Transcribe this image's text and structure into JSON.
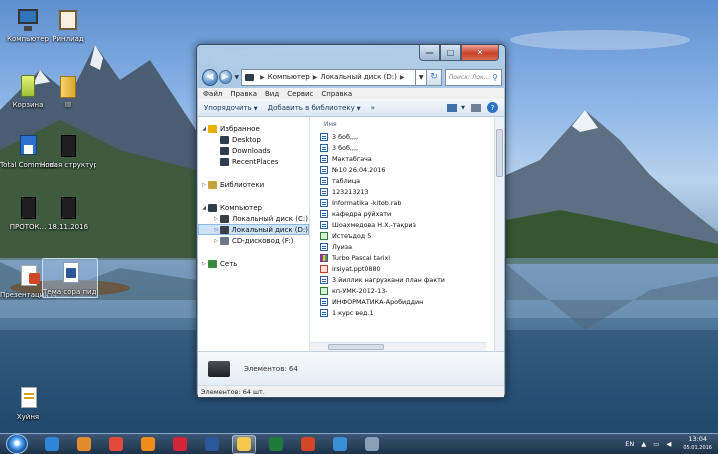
{
  "desktop": {
    "icons": [
      {
        "label": "Компьютер",
        "icon": "computer-icon"
      },
      {
        "label": "Ринлиад",
        "icon": "book-icon"
      },
      {
        "label": "Корзина",
        "icon": "recycle-bin-icon"
      },
      {
        "label": "III",
        "icon": "folder-icon"
      },
      {
        "label": "Total Commander",
        "icon": "floppy-icon"
      },
      {
        "label": "Новая структура...",
        "icon": "book-icon"
      },
      {
        "label": "ПРОТОК...",
        "icon": "book-icon"
      },
      {
        "label": "18.11.2016",
        "icon": "book-icon"
      },
      {
        "label": "Презентация Microsoft P...",
        "icon": "powerpoint-icon"
      },
      {
        "label": "Тема сора пидагога",
        "icon": "word-document-icon"
      },
      {
        "label": "Хуйня",
        "icon": "document-icon"
      }
    ]
  },
  "window": {
    "buttons": {
      "minimize": "—",
      "maximize": "□",
      "close": "✕"
    },
    "address": {
      "breadcrumbs": [
        "Компьютер",
        "Локальный диск (D:)"
      ]
    },
    "search": {
      "placeholder": "Поиск: Лок..."
    },
    "menu": [
      "Файл",
      "Правка",
      "Вид",
      "Сервис",
      "Справка"
    ],
    "commands": {
      "organize": "Упорядочить",
      "add_to_library": "Добавить в библиотеку",
      "more": "»"
    },
    "nav_pane": [
      {
        "label": "Избранное",
        "level": 0,
        "expander": "◢",
        "icon": "star-icon",
        "color": "#e8b100"
      },
      {
        "label": "Desktop",
        "level": 1,
        "expander": "",
        "icon": "desktop-icon",
        "color": "#2f3d4e"
      },
      {
        "label": "Downloads",
        "level": 1,
        "expander": "",
        "icon": "downloads-icon",
        "color": "#2f3d4e"
      },
      {
        "label": "RecentPlaces",
        "level": 1,
        "expander": "",
        "icon": "recent-places-icon",
        "color": "#2f3d4e"
      },
      {
        "gap": true
      },
      {
        "label": "Библиотеки",
        "level": 0,
        "expander": "▷",
        "icon": "library-icon",
        "color": "#c9a13a"
      },
      {
        "gap": true
      },
      {
        "label": "Компьютер",
        "level": 0,
        "expander": "◢",
        "icon": "computer-icon",
        "color": "#2f3d4e"
      },
      {
        "label": "Локальный диск (C:)",
        "level": 1,
        "expander": "▷",
        "icon": "drive-icon",
        "color": "#3a3f46"
      },
      {
        "label": "Локальный диск (D:)",
        "level": 1,
        "expander": "▷",
        "icon": "drive-icon",
        "color": "#3a3f46",
        "selected": true
      },
      {
        "label": "CD-дисковод (F:)",
        "level": 1,
        "expander": "▷",
        "icon": "cd-drive-icon",
        "color": "#6b7785"
      },
      {
        "gap": true
      },
      {
        "label": "Сеть",
        "level": 0,
        "expander": "▷",
        "icon": "network-icon",
        "color": "#3c8a3c"
      }
    ],
    "column_header": "Имя",
    "files": [
      {
        "name": "3 боб,,,,",
        "type": "word"
      },
      {
        "name": "3 боб,,,,",
        "type": "word"
      },
      {
        "name": "Мактабгача",
        "type": "word"
      },
      {
        "name": "№10 26.04.2016",
        "type": "word"
      },
      {
        "name": "таблица",
        "type": "word"
      },
      {
        "name": "123213213",
        "type": "word"
      },
      {
        "name": "Informatika -kitob.rab",
        "type": "word"
      },
      {
        "name": "кафедра рўйхати",
        "type": "word"
      },
      {
        "name": "Шоахмедова Н.Х.-тақриз",
        "type": "word"
      },
      {
        "name": "Истеъдод 5",
        "type": "excel"
      },
      {
        "name": "Луиза",
        "type": "word"
      },
      {
        "name": "Turbo Pascal tarixi",
        "type": "rar"
      },
      {
        "name": "irsiyat.ppt0880",
        "type": "ppt"
      },
      {
        "name": "3 йиллик нагрузкани план факти",
        "type": "word"
      },
      {
        "name": "кп-УМК-2012-13-",
        "type": "excel"
      },
      {
        "name": "ИНФОРМАТИКА-Аробиддин",
        "type": "word"
      },
      {
        "name": "1 курс вед.1",
        "type": "word"
      }
    ],
    "details": {
      "count_text": "Элементов: 64"
    },
    "status": {
      "text": "Элементов: 64 шт."
    }
  },
  "taskbar": {
    "items": [
      {
        "icon": "internet-explorer-icon",
        "color": "#2f84d6"
      },
      {
        "icon": "media-player-icon",
        "color": "#e08a2b"
      },
      {
        "icon": "chrome-icon",
        "color": "#e34a3a"
      },
      {
        "icon": "firefox-icon",
        "color": "#f08c1c"
      },
      {
        "icon": "opera-icon",
        "color": "#d1263a"
      },
      {
        "icon": "word-icon",
        "color": "#2b579a"
      },
      {
        "icon": "explorer-folder-icon",
        "color": "#f2c94c",
        "active": true
      },
      {
        "icon": "excel-icon",
        "color": "#1f7a3c"
      },
      {
        "icon": "powerpoint-icon",
        "color": "#d24726"
      },
      {
        "icon": "paint-icon",
        "color": "#3a8fd6"
      },
      {
        "icon": "app-icon",
        "color": "#8aa0b6"
      }
    ],
    "tray": {
      "language": "EN",
      "show_hidden": "▲",
      "network": "▭",
      "volume": "◀",
      "time": "13:04",
      "date": "05.01.2016"
    }
  }
}
